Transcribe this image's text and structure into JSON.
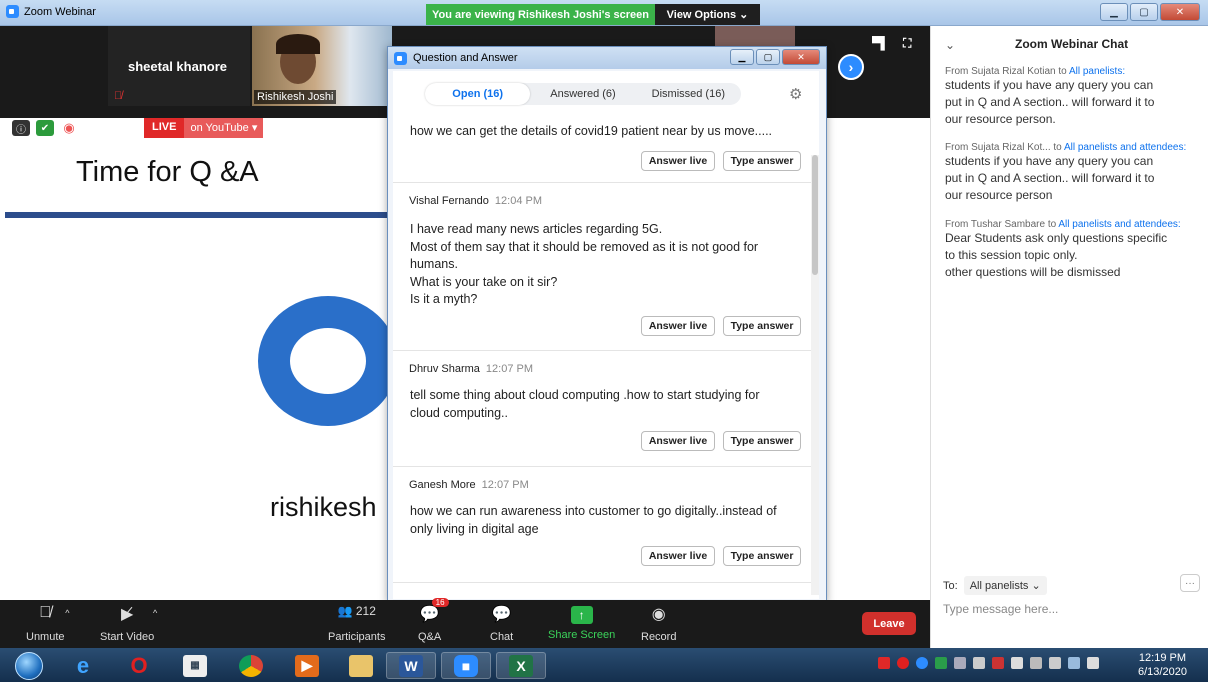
{
  "window": {
    "title": "Zoom Webinar",
    "viewing_banner": "You are viewing Rishikesh Joshi's screen",
    "view_options": "View Options ⌄",
    "minimize_icon": "minimize-icon",
    "maximize_icon": "maximize-icon",
    "close_icon": "close-icon"
  },
  "video": {
    "tile1_name": "sheetal khanore",
    "tile2_name": "Rishikesh Joshi"
  },
  "slide": {
    "live_label": "LIVE",
    "live_target": "on YouTube ▾",
    "title": "Time for Q &A",
    "presenter_text": "rishikesh"
  },
  "qa": {
    "window_title": "Question and Answer",
    "tabs": [
      {
        "label": "Open (16)"
      },
      {
        "label": "Answered (6)"
      },
      {
        "label": "Dismissed (16)"
      }
    ],
    "answer_live_label": "Answer live",
    "type_answer_label": "Type answer",
    "questions": [
      {
        "author": "",
        "time": "",
        "text": "how we can get the details of covid19 patient near by us move....."
      },
      {
        "author": "Vishal Fernando",
        "time": "12:04 PM",
        "text": "I have read many news articles regarding 5G.\nMost of them say that it should be removed as it is not good for humans.\nWhat is your take on it sir?\nIs it a myth?"
      },
      {
        "author": "Dhruv Sharma",
        "time": "12:07 PM",
        "text": "tell some thing about cloud computing .how to start studying for cloud computing.."
      },
      {
        "author": "Ganesh More",
        "time": "12:07 PM",
        "text": "how we can run awareness into customer to go digitally..instead of only living in digital age"
      }
    ]
  },
  "chat": {
    "title": "Zoom Webinar Chat",
    "messages": [
      {
        "from": "From Sujata Rizal Kotian to ",
        "to": "All panelists:",
        "body": "students if you have any query you can\nput in Q and A section.. will forward it to\nour resource person."
      },
      {
        "from": "From Sujata Rizal Kot... to ",
        "to": "All panelists and attendees:",
        "body": "students if you have any query you can\nput in Q and A section.. will forward it to\nour resource person"
      },
      {
        "from": "From Tushar Sambare to ",
        "to": "All panelists and attendees:",
        "body": "Dear Students ask only questions specific\nto this session topic only.\nother questions will be dismissed"
      }
    ],
    "to_label": "To:",
    "to_value": "All panelists ⌄",
    "more": "···",
    "placeholder": "Type message here..."
  },
  "toolbar": {
    "unmute": "Unmute",
    "start_video": "Start Video",
    "participants": "Participants",
    "participant_count": "212",
    "qa": "Q&A",
    "qa_badge": "16",
    "chat": "Chat",
    "share": "Share Screen",
    "record": "Record",
    "leave": "Leave"
  },
  "taskbar": {
    "time": "12:19 PM",
    "date": "6/13/2020"
  }
}
